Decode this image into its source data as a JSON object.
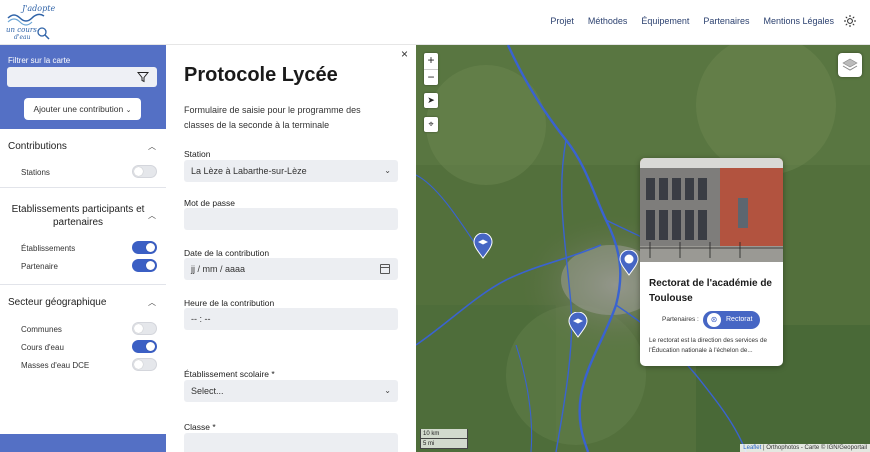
{
  "logo": {
    "line1": "J'adopte",
    "line2": "un cours",
    "line3": "d'eau"
  },
  "nav": [
    "Projet",
    "Méthodes",
    "Équipement",
    "Partenaires",
    "Mentions Légales"
  ],
  "sidebar": {
    "filter_label": "Filtrer sur la carte",
    "filter_value": "",
    "add_button": "Ajouter une contribution",
    "add_chevron": "⌄",
    "sections": {
      "contributions": {
        "title": "Contributions",
        "items": [
          {
            "label": "Stations",
            "on": false
          }
        ]
      },
      "etablissements": {
        "title": "Etablissements participants et partenaires",
        "items": [
          {
            "label": "Établissements",
            "on": true
          },
          {
            "label": "Partenaire",
            "on": true
          }
        ]
      },
      "secteur": {
        "title": "Secteur géographique",
        "items": [
          {
            "label": "Communes",
            "on": false
          },
          {
            "label": "Cours d'eau",
            "on": true
          },
          {
            "label": "Masses d'eau DCE",
            "on": false
          }
        ]
      }
    }
  },
  "form": {
    "close": "×",
    "title": "Protocole Lycée",
    "description": "Formulaire de saisie pour le programme des classes de la seconde à la terminale",
    "station_label": "Station",
    "station_value": "La Lèze à Labarthe-sur-Lèze",
    "password_label": "Mot de passe",
    "password_value": "",
    "date_label": "Date de la contribution",
    "date_placeholder": "jj / mm / aaaa",
    "time_label": "Heure de la contribution",
    "time_placeholder": "-- : --",
    "school_label": "Établissement scolaire *",
    "school_value": "Select...",
    "class_label": "Classe *",
    "class_value": ""
  },
  "map": {
    "zoom_in": "+",
    "zoom_out": "−",
    "scale_km": "10 km",
    "scale_mi": "5 mi",
    "attribution_link": "Leaflet",
    "attribution_text": "| Orthophotos - Carte © IGN/Geoportail",
    "popup": {
      "title": "Rectorat de l'académie de Toulouse",
      "partners_label": "Partenaires :",
      "badge": "Rectorat",
      "text": "Le rectorat est la direction des services de l'Éducation nationale à l'échelon de..."
    }
  }
}
